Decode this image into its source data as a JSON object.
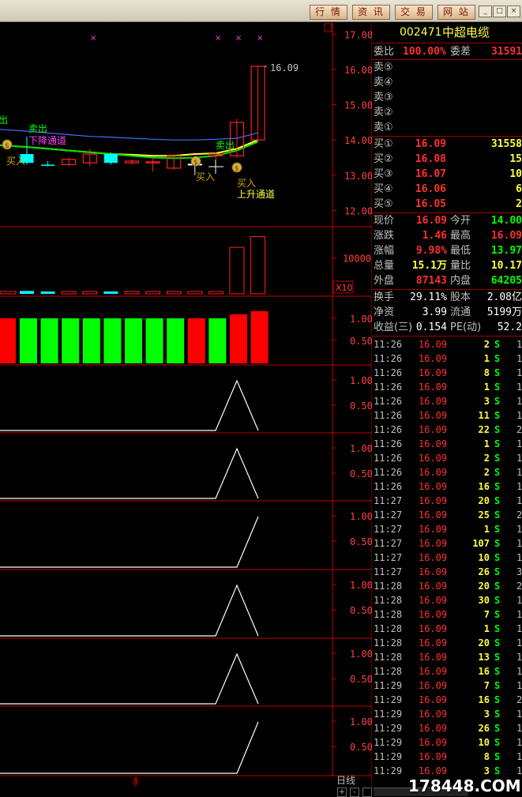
{
  "toolbar": {
    "buttons": [
      "行 情",
      "资 讯",
      "交 易",
      "网 站"
    ],
    "window_controls": [
      "_",
      "□",
      "×"
    ]
  },
  "stock": {
    "code": "002471",
    "name": "中超电缆"
  },
  "order_book": {
    "weibi_label": "委比",
    "weibi_value": "100.00%",
    "weicha_label": "委差",
    "weicha_value": "31591",
    "sells": [
      {
        "label": "卖⑤",
        "price": "",
        "vol": ""
      },
      {
        "label": "卖④",
        "price": "",
        "vol": ""
      },
      {
        "label": "卖③",
        "price": "",
        "vol": ""
      },
      {
        "label": "卖②",
        "price": "",
        "vol": ""
      },
      {
        "label": "卖①",
        "price": "",
        "vol": ""
      }
    ],
    "buys": [
      {
        "label": "买①",
        "price": "16.09",
        "vol": "31558"
      },
      {
        "label": "买②",
        "price": "16.08",
        "vol": "15"
      },
      {
        "label": "买③",
        "price": "16.07",
        "vol": "10"
      },
      {
        "label": "买④",
        "price": "16.06",
        "vol": "6"
      },
      {
        "label": "买⑤",
        "price": "16.05",
        "vol": "2"
      }
    ]
  },
  "stats": [
    {
      "l1": "现价",
      "v1": "16.09",
      "l2": "今开",
      "v2": "14.00"
    },
    {
      "l1": "涨跌",
      "v1": "1.46",
      "l2": "最高",
      "v2": "16.09"
    },
    {
      "l1": "涨幅",
      "v1": "9.98%",
      "l2": "最低",
      "v2": "13.97"
    },
    {
      "l1": "总量",
      "v1": "15.1万",
      "l2": "量比",
      "v2": "10.17"
    },
    {
      "l1": "外盘",
      "v1": "87143",
      "l2": "内盘",
      "v2": "64205"
    }
  ],
  "stats2": [
    {
      "l1": "换手",
      "v1": "29.11%",
      "l2": "股本",
      "v2": "2.08亿"
    },
    {
      "l1": "净资",
      "v1": "3.99",
      "l2": "流通",
      "v2": "5199万"
    },
    {
      "l1": "收益(三)",
      "v1": "0.154",
      "l2": "PE(动)",
      "v2": "52.2"
    }
  ],
  "ticks": [
    {
      "t": "11:26",
      "p": "16.09",
      "v": "2",
      "s": "S",
      "x": "1"
    },
    {
      "t": "11:26",
      "p": "16.09",
      "v": "1",
      "s": "S",
      "x": "1"
    },
    {
      "t": "11:26",
      "p": "16.09",
      "v": "8",
      "s": "S",
      "x": "1"
    },
    {
      "t": "11:26",
      "p": "16.09",
      "v": "1",
      "s": "S",
      "x": "1"
    },
    {
      "t": "11:26",
      "p": "16.09",
      "v": "3",
      "s": "S",
      "x": "1"
    },
    {
      "t": "11:26",
      "p": "16.09",
      "v": "11",
      "s": "S",
      "x": "1"
    },
    {
      "t": "11:26",
      "p": "16.09",
      "v": "22",
      "s": "S",
      "x": "2"
    },
    {
      "t": "11:26",
      "p": "16.09",
      "v": "1",
      "s": "S",
      "x": "1"
    },
    {
      "t": "11:26",
      "p": "16.09",
      "v": "2",
      "s": "S",
      "x": "1"
    },
    {
      "t": "11:26",
      "p": "16.09",
      "v": "2",
      "s": "S",
      "x": "1"
    },
    {
      "t": "11:26",
      "p": "16.09",
      "v": "16",
      "s": "S",
      "x": "1"
    },
    {
      "t": "11:27",
      "p": "16.09",
      "v": "20",
      "s": "S",
      "x": "1"
    },
    {
      "t": "11:27",
      "p": "16.09",
      "v": "25",
      "s": "S",
      "x": "2"
    },
    {
      "t": "11:27",
      "p": "16.09",
      "v": "1",
      "s": "S",
      "x": "1"
    },
    {
      "t": "11:27",
      "p": "16.09",
      "v": "107",
      "s": "S",
      "x": "1"
    },
    {
      "t": "11:27",
      "p": "16.09",
      "v": "10",
      "s": "S",
      "x": "1"
    },
    {
      "t": "11:27",
      "p": "16.09",
      "v": "26",
      "s": "S",
      "x": "3"
    },
    {
      "t": "11:28",
      "p": "16.09",
      "v": "20",
      "s": "S",
      "x": "2"
    },
    {
      "t": "11:28",
      "p": "16.09",
      "v": "30",
      "s": "S",
      "x": "1"
    },
    {
      "t": "11:28",
      "p": "16.09",
      "v": "7",
      "s": "S",
      "x": "1"
    },
    {
      "t": "11:28",
      "p": "16.09",
      "v": "1",
      "s": "S",
      "x": "1"
    },
    {
      "t": "11:28",
      "p": "16.09",
      "v": "20",
      "s": "S",
      "x": "1"
    },
    {
      "t": "11:28",
      "p": "16.09",
      "v": "13",
      "s": "S",
      "x": "1"
    },
    {
      "t": "11:28",
      "p": "16.09",
      "v": "16",
      "s": "S",
      "x": "1"
    },
    {
      "t": "11:29",
      "p": "16.09",
      "v": "7",
      "s": "S",
      "x": "1"
    },
    {
      "t": "11:29",
      "p": "16.09",
      "v": "16",
      "s": "S",
      "x": "2"
    },
    {
      "t": "11:29",
      "p": "16.09",
      "v": "3",
      "s": "S",
      "x": "1"
    },
    {
      "t": "11:29",
      "p": "16.09",
      "v": "26",
      "s": "S",
      "x": "1"
    },
    {
      "t": "11:29",
      "p": "16.09",
      "v": "10",
      "s": "S",
      "x": "1"
    },
    {
      "t": "11:29",
      "p": "16.09",
      "v": "8",
      "s": "S",
      "x": "1"
    },
    {
      "t": "11:29",
      "p": "16.09",
      "v": "3",
      "s": "S",
      "x": "1"
    }
  ],
  "chart_data": {
    "type": "candlestick",
    "price_axis": [
      "17.00",
      "16.00",
      "15.00",
      "14.00",
      "13.00",
      "12.00"
    ],
    "price_ylim": [
      11.65,
      17.3
    ],
    "last_price_label": "16.09",
    "annotations": [
      "出",
      "卖出",
      "下降通道",
      "买入",
      "卖出",
      "买入",
      "买入",
      "上升通道"
    ],
    "candles": [
      {
        "open": 13.6,
        "high": 14.1,
        "low": 13.3,
        "close": 13.35,
        "color": "cyan"
      },
      {
        "open": 13.3,
        "high": 13.4,
        "low": 13.25,
        "close": 13.3,
        "color": "cyan"
      },
      {
        "open": 13.3,
        "high": 13.5,
        "low": 13.25,
        "close": 13.45,
        "color": "red"
      },
      {
        "open": 13.35,
        "high": 13.75,
        "low": 13.25,
        "close": 13.6,
        "color": "red"
      },
      {
        "open": 13.6,
        "high": 13.65,
        "low": 13.3,
        "close": 13.35,
        "color": "cyan"
      },
      {
        "open": 13.35,
        "high": 13.45,
        "low": 13.3,
        "close": 13.4,
        "color": "red"
      },
      {
        "open": 13.35,
        "high": 13.5,
        "low": 13.1,
        "close": 13.38,
        "color": "red"
      },
      {
        "open": 13.2,
        "high": 13.6,
        "low": 13.15,
        "close": 13.55,
        "color": "red"
      },
      {
        "open": 13.3,
        "high": 13.55,
        "low": 13.0,
        "close": 13.3,
        "color": "white"
      },
      {
        "open": 13.55,
        "high": 13.65,
        "low": 13.45,
        "close": 13.6,
        "color": "red"
      },
      {
        "open": 13.55,
        "high": 14.6,
        "low": 13.5,
        "close": 14.5,
        "color": "red"
      },
      {
        "open": 14.0,
        "high": 16.1,
        "low": 13.97,
        "close": 16.09,
        "color": "red"
      }
    ],
    "ma_lines": [
      {
        "name": "",
        "color": "#3f6fff",
        "values": [
          14.25,
          14.2,
          14.15,
          14.1,
          14.08,
          14.05,
          14.02,
          14.0,
          14.0,
          14.02,
          14.05,
          14.2
        ]
      },
      {
        "name": "",
        "color": "#ffff40",
        "values": [
          13.8,
          13.75,
          13.7,
          13.65,
          13.6,
          13.58,
          13.55,
          13.55,
          13.6,
          13.62,
          13.75,
          14.0
        ]
      },
      {
        "name": "",
        "color": "#00e000",
        "values": [
          13.8,
          13.75,
          13.7,
          13.65,
          13.6,
          13.55,
          13.5,
          13.48,
          13.5,
          13.55,
          13.7,
          13.95
        ]
      }
    ],
    "volume": {
      "axis_label": "10000",
      "multiplier": "X10",
      "values": [
        800,
        500,
        300,
        200,
        400,
        300,
        300,
        250,
        300,
        300,
        13000,
        16000
      ]
    },
    "signal_panel": {
      "axis": [
        "1.00",
        "0.50"
      ],
      "colors": [
        "red",
        "green",
        "green",
        "green",
        "green",
        "green",
        "green",
        "green",
        "green",
        "red",
        "green",
        "red",
        "red"
      ]
    },
    "indicator_panels": [
      {
        "axis": [
          "1.00",
          "0.50"
        ],
        "shape": "peak"
      },
      {
        "axis": [
          "1.00",
          "0.50"
        ],
        "shape": "peak"
      },
      {
        "axis": [
          "1.00",
          "0.50"
        ],
        "shape": "rise"
      },
      {
        "axis": [
          "1.00",
          "0.50"
        ],
        "shape": "peak"
      },
      {
        "axis": [
          "1.00",
          "0.50"
        ],
        "shape": "peak"
      },
      {
        "axis": [
          "1.00",
          "0.50"
        ],
        "shape": "rise"
      }
    ],
    "bottom_label": "日线",
    "bottom_marker": "8"
  },
  "colors": {
    "up": "#ff2020",
    "down": "#00ffff",
    "axis": "#c00000",
    "label": "#ff4040",
    "text": "#c0c0c0"
  },
  "watermark": "178448.COM"
}
